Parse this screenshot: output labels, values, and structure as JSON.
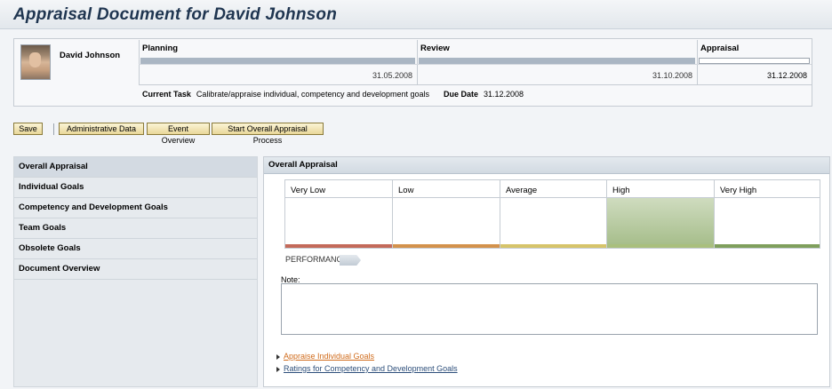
{
  "page": {
    "title": "Appraisal Document for David Johnson"
  },
  "employee": {
    "name": "David Johnson",
    "photo_icon": "employee-photo"
  },
  "phases": [
    {
      "label": "Planning",
      "date": "31.05.2008",
      "progress": 1.0
    },
    {
      "label": "Review",
      "date": "31.10.2008",
      "progress": 1.0
    },
    {
      "label": "Appraisal",
      "date": "31.12.2008",
      "progress": 0.0
    }
  ],
  "task": {
    "label": "Current Task",
    "value": "Calibrate/appraise individual, competency and development goals",
    "due_label": "Due Date",
    "due_value": "31.12.2008"
  },
  "toolbar": {
    "save": "Save",
    "admin": "Administrative Data",
    "events": "Event Overview",
    "start": "Start Overall Appraisal Process"
  },
  "nav": [
    "Overall Appraisal",
    "Individual Goals",
    "Competency and Development Goals",
    "Team Goals",
    "Obsolete Goals",
    "Document Overview"
  ],
  "panel": {
    "title": "Overall Appraisal",
    "scale": [
      "Very Low",
      "Low",
      "Average",
      "High",
      "Very High"
    ],
    "selected": "High",
    "strip_colors": [
      "#c46a5a",
      "#d3924c",
      "#d6c46a",
      "#a9bf7d",
      "#7f9f5c"
    ],
    "performance_label": "PERFORMANCE",
    "note_label": "Note:",
    "note_value": "",
    "links": [
      "Appraise Individual Goals",
      "Ratings for Competency and Development Goals"
    ]
  }
}
